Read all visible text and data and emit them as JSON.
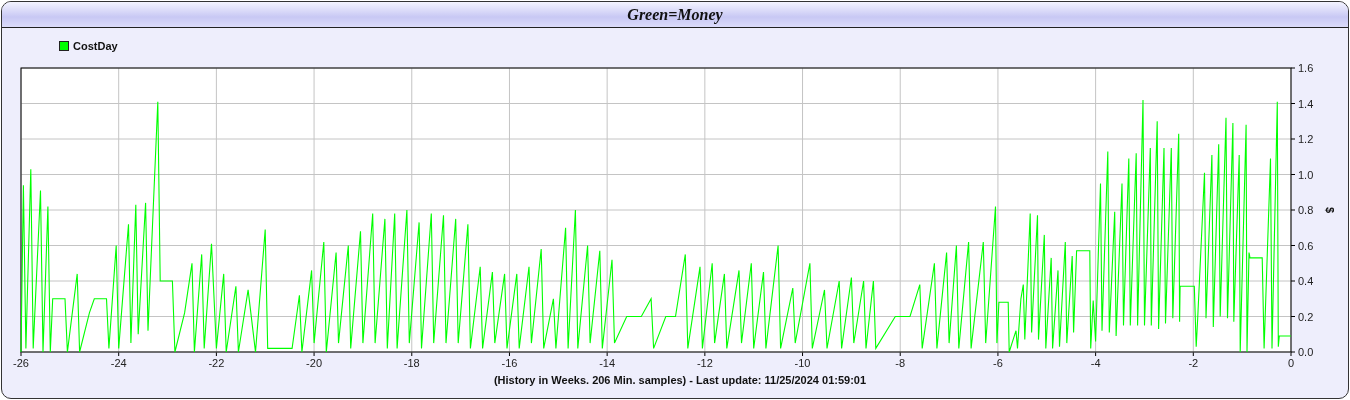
{
  "window": {
    "title": "Green=Money"
  },
  "chart": {
    "chart_data": {
      "type": "line",
      "grid": true,
      "ylabel": "$",
      "xlim": [
        -26,
        0
      ],
      "ylim": [
        0,
        1.6
      ],
      "xticks": [
        -26,
        -24,
        -22,
        -20,
        -18,
        -16,
        -14,
        -12,
        -10,
        -8,
        -6,
        -4,
        -2,
        0
      ],
      "yticks": [
        {
          "value": 0,
          "label": "0.0"
        },
        {
          "value": 0.2,
          "label": "0.2"
        },
        {
          "value": 0.4,
          "label": "0.4"
        },
        {
          "value": 0.6,
          "label": "0.6"
        },
        {
          "value": 0.8,
          "label": "0.8"
        },
        {
          "value": 1,
          "label": "1.0"
        },
        {
          "value": 1.2,
          "label": "1.2"
        },
        {
          "value": 1.4,
          "label": "1.4"
        },
        {
          "value": 1.6,
          "label": "1.6"
        }
      ],
      "x": [
        -26,
        -25.95,
        -25.9,
        -25.8,
        -25.75,
        -25.6,
        -25.55,
        -25.45,
        -25.4,
        -25.35,
        -25.1,
        -25.05,
        -24.85,
        -24.8,
        -24.6,
        -24.5,
        -24.25,
        -24.2,
        -24.05,
        -24,
        -23.8,
        -23.75,
        -23.65,
        -23.6,
        -23.45,
        -23.4,
        -23.2,
        -23.15,
        -22.9,
        -22.85,
        -22.65,
        -22.5,
        -22.45,
        -22.3,
        -22.25,
        -22.1,
        -22,
        -21.85,
        -21.8,
        -21.6,
        -21.55,
        -21.35,
        -21.2,
        -21,
        -20.95,
        -20.8,
        -20.45,
        -20.3,
        -20.25,
        -20.05,
        -20,
        -19.8,
        -19.75,
        -19.55,
        -19.5,
        -19.3,
        -19.25,
        -19.05,
        -19,
        -18.8,
        -18.75,
        -18.55,
        -18.5,
        -18.35,
        -18.3,
        -18.1,
        -18.05,
        -17.85,
        -17.8,
        -17.6,
        -17.55,
        -17.35,
        -17.3,
        -17.1,
        -17.05,
        -16.85,
        -16.8,
        -16.6,
        -16.55,
        -16.35,
        -16.3,
        -16.1,
        -16.05,
        -15.85,
        -15.8,
        -15.6,
        -15.55,
        -15.35,
        -15.3,
        -15.1,
        -15.05,
        -14.85,
        -14.8,
        -14.65,
        -14.6,
        -14.4,
        -14.35,
        -14.15,
        -14.1,
        -13.9,
        -13.85,
        -13.6,
        -13.3,
        -13.1,
        -13.05,
        -12.8,
        -12.6,
        -12.4,
        -12.35,
        -12.1,
        -12.05,
        -11.85,
        -11.8,
        -11.6,
        -11.55,
        -11.3,
        -11.25,
        -11.05,
        -11,
        -10.8,
        -10.75,
        -10.5,
        -10.45,
        -10.2,
        -10.15,
        -9.85,
        -9.8,
        -9.55,
        -9.5,
        -9.25,
        -9.2,
        -9,
        -8.95,
        -8.75,
        -8.7,
        -8.55,
        -8.5,
        -8.1,
        -7.8,
        -7.6,
        -7.55,
        -7.3,
        -7.25,
        -7.05,
        -7,
        -6.85,
        -6.8,
        -6.6,
        -6.55,
        -6.3,
        -6.25,
        -6.05,
        -6.02,
        -5.98,
        -5.79,
        -5.77,
        -5.63,
        -5.6,
        -5.53,
        -5.48,
        -5.45,
        -5.34,
        -5.31,
        -5.19,
        -5.17,
        -5.05,
        -5.02,
        -4.91,
        -4.88,
        -4.77,
        -4.74,
        -4.62,
        -4.59,
        -4.48,
        -4.45,
        -4.39,
        -4.12,
        -4.1,
        -4.05,
        -4,
        -3.9,
        -3.87,
        -3.75,
        -3.72,
        -3.61,
        -3.58,
        -3.46,
        -3.43,
        -3.32,
        -3.29,
        -3.17,
        -3.14,
        -3.03,
        -3,
        -2.88,
        -2.86,
        -2.74,
        -2.71,
        -2.6,
        -2.57,
        -2.45,
        -2.42,
        -2.3,
        -2.28,
        -2.27,
        -1.98,
        -1.94,
        -1.91,
        -1.77,
        -1.74,
        -1.62,
        -1.59,
        -1.48,
        -1.45,
        -1.33,
        -1.3,
        -1.19,
        -1.17,
        -1.06,
        -1.04,
        -0.92,
        -0.9,
        -0.86,
        -0.84,
        -0.59,
        -0.55,
        -0.42,
        -0.39,
        -0.28,
        -0.26,
        -0.24,
        0
      ],
      "series": [
        {
          "name": "CostDay",
          "color": "#00ff00",
          "values": [
            0,
            0.94,
            0.02,
            1.03,
            0.02,
            0.91,
            0,
            0.82,
            0,
            0.3,
            0.3,
            0,
            0.44,
            0,
            0.22,
            0.3,
            0.3,
            0.02,
            0.6,
            0.02,
            0.72,
            0.05,
            0.83,
            0.1,
            0.84,
            0.12,
            1.41,
            0.4,
            0.4,
            0,
            0.22,
            0.5,
            0,
            0.55,
            0.02,
            0.61,
            0.02,
            0.44,
            0,
            0.37,
            0,
            0.35,
            0,
            0.69,
            0.02,
            0.02,
            0.02,
            0.32,
            0,
            0.46,
            0.05,
            0.62,
            0,
            0.56,
            0.05,
            0.6,
            0.02,
            0.68,
            0.05,
            0.78,
            0.05,
            0.75,
            0.02,
            0.78,
            0.02,
            0.8,
            0.05,
            0.73,
            0.02,
            0.78,
            0.05,
            0.77,
            0.05,
            0.75,
            0.05,
            0.72,
            0.02,
            0.48,
            0.02,
            0.45,
            0.05,
            0.44,
            0.02,
            0.44,
            0.02,
            0.48,
            0.05,
            0.58,
            0.02,
            0.3,
            0.02,
            0.7,
            0.02,
            0.8,
            0.02,
            0.6,
            0.05,
            0.57,
            0.02,
            0.52,
            0.05,
            0.2,
            0.2,
            0.3,
            0.02,
            0.2,
            0.2,
            0.55,
            0.02,
            0.48,
            0.02,
            0.5,
            0.05,
            0.44,
            0.02,
            0.46,
            0.05,
            0.5,
            0.02,
            0.45,
            0.02,
            0.6,
            0.02,
            0.36,
            0.05,
            0.5,
            0.02,
            0.35,
            0.02,
            0.4,
            0.02,
            0.42,
            0.05,
            0.4,
            0.02,
            0.4,
            0.02,
            0.2,
            0.2,
            0.38,
            0.02,
            0.5,
            0.02,
            0.56,
            0.05,
            0.6,
            0.02,
            0.62,
            0.02,
            0.62,
            0.05,
            0.82,
            0.05,
            0.28,
            0.28,
            0,
            0.12,
            0.02,
            0.3,
            0.38,
            0.07,
            0.78,
            0.11,
            0.77,
            0.07,
            0.66,
            0.02,
            0.53,
            0.02,
            0.46,
            0.03,
            0.62,
            0.05,
            0.54,
            0.11,
            0.57,
            0.57,
            0.02,
            0.29,
            0.06,
            0.95,
            0.12,
            1.13,
            0.11,
            0.79,
            0.09,
            0.95,
            0.15,
            1.09,
            0.15,
            1.12,
            0.15,
            1.42,
            0.15,
            1.15,
            0.15,
            1.3,
            0.13,
            1.15,
            0.16,
            1.15,
            0.19,
            1.23,
            0.17,
            0.37,
            0.37,
            0.03,
            0.19,
            1.01,
            0.19,
            1.11,
            0.14,
            1.17,
            0.2,
            1.32,
            0.19,
            1.29,
            0.17,
            1.11,
            0,
            1.28,
            0,
            0.56,
            0.53,
            0.53,
            0.02,
            1.09,
            0.02,
            1.41,
            0.03,
            0.09,
            0.09
          ]
        }
      ]
    },
    "caption": "(History in Weeks. 206 Min. samples) - Last update: 11/25/2024 01:59:01"
  }
}
